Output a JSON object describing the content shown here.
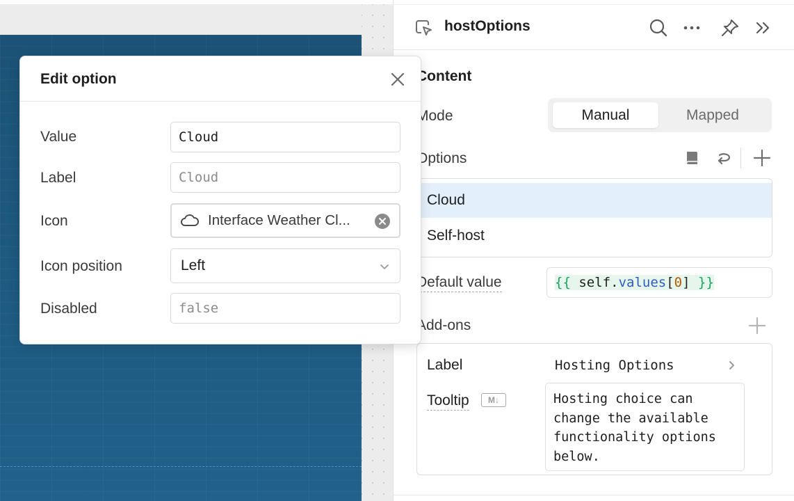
{
  "inspector": {
    "component_name": "hostOptions",
    "content_title": "Content",
    "mode": {
      "label": "Mode",
      "options": [
        "Manual",
        "Mapped"
      ],
      "selected": "Manual"
    },
    "options": {
      "label": "Options",
      "items": [
        "Cloud",
        "Self-host"
      ],
      "selected": "Cloud"
    },
    "default_value": {
      "label": "Default value",
      "expr_open": "{{",
      "expr_obj": "self",
      "expr_dot": ".",
      "expr_prop": "values",
      "expr_lb": "[",
      "expr_idx": "0",
      "expr_rb": "]",
      "expr_close": "}}"
    },
    "addons": {
      "title": "Add-ons",
      "label_key": "Label",
      "label_value": "Hosting Options",
      "tooltip_key": "Tooltip",
      "markdown_badge": "M↓",
      "tooltip_value": "Hosting choice can\nchange the available\nfunctionality options\nbelow."
    }
  },
  "modal": {
    "title": "Edit option",
    "fields": {
      "value": {
        "label": "Value",
        "value": "Cloud"
      },
      "label": {
        "label": "Label",
        "placeholder": "Cloud"
      },
      "icon": {
        "label": "Icon",
        "value": "Interface Weather Cl...",
        "icon": "cloud-icon"
      },
      "icon_position": {
        "label": "Icon position",
        "value": "Left"
      },
      "disabled": {
        "label": "Disabled",
        "placeholder": "false"
      }
    }
  },
  "colors": {
    "selected_row": "#e4effc",
    "canvas_blue": "#1e5a80",
    "expr_bracket": "#1aa260",
    "expr_prop": "#2f5bc4",
    "expr_number": "#b35a00"
  }
}
